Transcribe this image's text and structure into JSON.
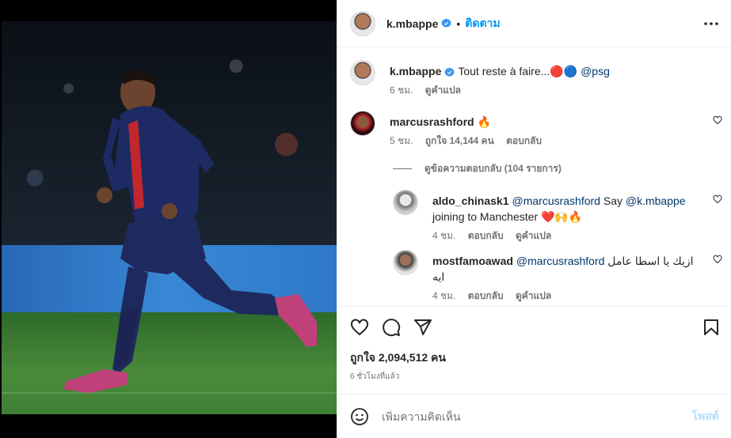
{
  "header": {
    "username": "k.mbappe",
    "separator": "•",
    "follow_label": "ติดตาม"
  },
  "caption": {
    "username": "k.mbappe",
    "text": "Tout reste à faire...",
    "emoji_red": "🔴",
    "emoji_blue": "🔵",
    "mention": "@psg",
    "time": "6 ชม.",
    "translate": "ดูคำแปล"
  },
  "comments": [
    {
      "username": "marcusrashford",
      "text": "🔥",
      "time": "5 ชม.",
      "likes": "ถูกใจ 14,144 คน",
      "reply": "ตอบกลับ"
    }
  ],
  "replies_toggle": "ดูข้อความตอบกลับ (104 รายการ)",
  "replies": [
    {
      "username": "aldo_chinask1",
      "mention": "@marcusrashford",
      "text_a": " Say ",
      "mention2": "@k.mbappe",
      "text_b": "joining to Manchester ❤️🙌🔥",
      "time": "4 ชม.",
      "reply": "ตอบกลับ",
      "translate": "ดูคำแปล"
    },
    {
      "username": "mostfamoawad",
      "mention": "@marcusrashford",
      "text_a": " ازيك يا اسطا عامل",
      "text_b": "ايه",
      "time": "4 ชม.",
      "reply": "ตอบกลับ",
      "translate": "ดูคำแปล"
    }
  ],
  "stats": {
    "likes": "ถูกใจ 2,094,512 คน",
    "time_ago": "6 ชั่วโมงที่แล้ว"
  },
  "composer": {
    "placeholder": "เพิ่มความคิดเห็น",
    "post_label": "โพสต์"
  },
  "icons": {
    "verified": "verified-badge-icon",
    "more": "more-options-icon",
    "like": "heart-icon",
    "comment": "comment-bubble-icon",
    "share": "paper-plane-icon",
    "save": "bookmark-icon",
    "emoji": "smiley-icon"
  },
  "colors": {
    "accent": "#0095f6",
    "verified": "#3897f0",
    "muted": "#737373",
    "post_disabled": "#b2dffc"
  }
}
